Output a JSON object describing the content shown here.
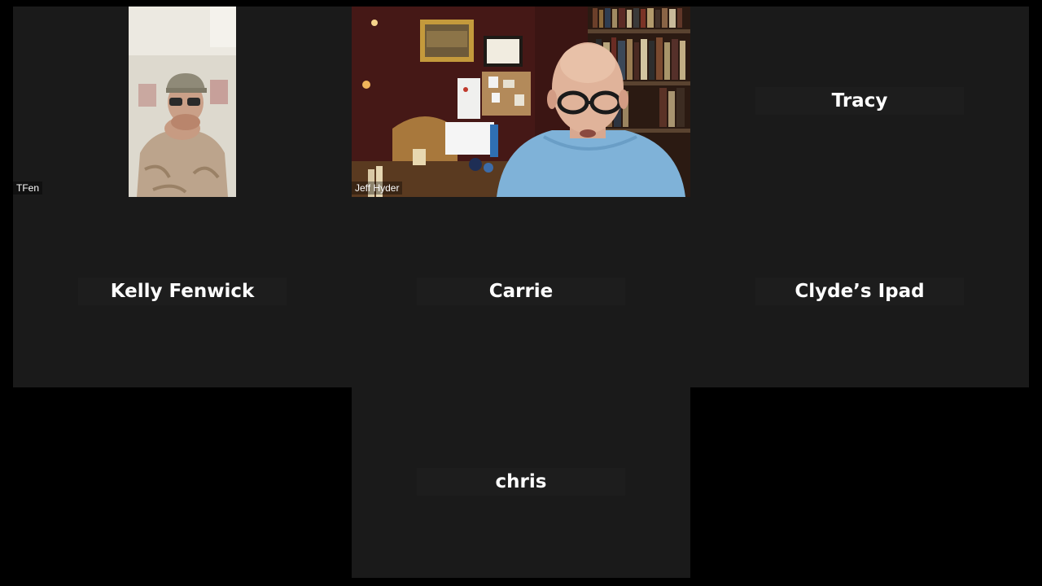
{
  "participants": [
    {
      "id": "tfen",
      "display_name": "TFen",
      "video": true
    },
    {
      "id": "jeff",
      "display_name": "Jeff Hyder",
      "video": true
    },
    {
      "id": "tracy",
      "display_name": "Tracy",
      "video": false
    },
    {
      "id": "kelly",
      "display_name": "Kelly Fenwick",
      "video": false
    },
    {
      "id": "carrie",
      "display_name": "Carrie",
      "video": false
    },
    {
      "id": "clyde",
      "display_name": "Clyde’s Ipad",
      "video": false
    },
    {
      "id": "chris",
      "display_name": "chris",
      "video": false
    }
  ],
  "colors": {
    "background": "#000000",
    "tile": "#1a1a1a",
    "name_plate": "#1d1d1d",
    "text": "#ffffff"
  }
}
